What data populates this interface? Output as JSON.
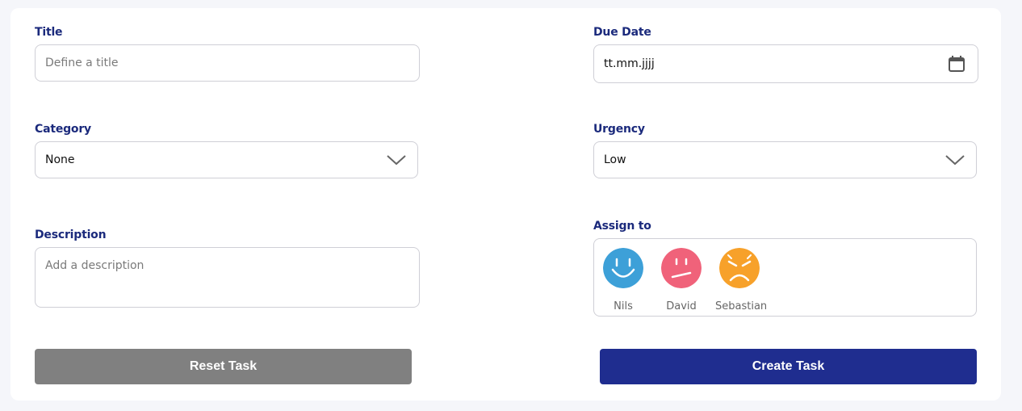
{
  "form": {
    "title": {
      "label": "Title",
      "placeholder": "Define a title"
    },
    "due_date": {
      "label": "Due Date",
      "value": "tt.mm.jjjj",
      "icon": "calendar-icon"
    },
    "category": {
      "label": "Category",
      "value": "None",
      "icon": "chevron-down-icon"
    },
    "urgency": {
      "label": "Urgency",
      "value": "Low",
      "icon": "chevron-down-icon"
    },
    "description": {
      "label": "Description",
      "placeholder": "Add a description"
    },
    "assign_to": {
      "label": "Assign to",
      "people": [
        {
          "name": "Nils",
          "color": "#3da0d8",
          "mood": "happy"
        },
        {
          "name": "David",
          "color": "#f0627a",
          "mood": "neutral"
        },
        {
          "name": "Sebastian",
          "color": "#f7a12a",
          "mood": "angry"
        }
      ]
    }
  },
  "actions": {
    "reset_label": "Reset Task",
    "create_label": "Create Task"
  },
  "colors": {
    "label": "#1b2a7c",
    "reset_button": "#808080",
    "create_button": "#1f2d8f",
    "background": "#f5f6fa"
  }
}
